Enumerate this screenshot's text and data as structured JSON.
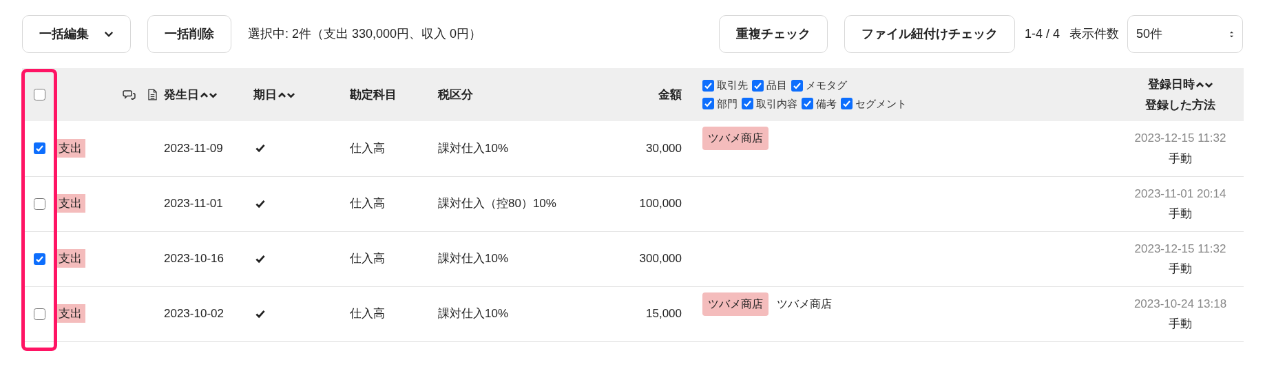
{
  "toolbar": {
    "bulk_edit": {
      "label": "一括編集"
    },
    "bulk_delete": {
      "label": "一括削除"
    },
    "selection_summary": "選択中: 2件（支出 330,000円、収入 0円）",
    "duplicate_check": {
      "label": "重複チェック"
    },
    "file_link_check": {
      "label": "ファイル紐付けチェック"
    },
    "pagination": "1-4 / 4",
    "per_page_label": "表示件数",
    "per_page": {
      "value": "50件"
    }
  },
  "table": {
    "select_all": {
      "checked": false
    },
    "columns": {
      "date": "発生日",
      "due": "期日",
      "account": "勘定科目",
      "tax": "税区分",
      "amount": "金額",
      "registered_at": "登録日時",
      "method": "登録した方法"
    },
    "display_options": [
      {
        "label": "取引先",
        "checked": true
      },
      {
        "label": "品目",
        "checked": true
      },
      {
        "label": "メモタグ",
        "checked": true
      },
      {
        "label": "部門",
        "checked": true
      },
      {
        "label": "取引内容",
        "checked": true
      },
      {
        "label": "備考",
        "checked": true
      },
      {
        "label": "セグメント",
        "checked": true
      }
    ],
    "rows": [
      {
        "selected": true,
        "type": "支出",
        "date": "2023-11-09",
        "due_settled": true,
        "account": "仕入高",
        "tax": "課対仕入10%",
        "amount": "30,000",
        "tags": [
          "ツバメ商店"
        ],
        "registered_at": "2023-12-15 11:32",
        "method": "手動"
      },
      {
        "selected": false,
        "type": "支出",
        "date": "2023-11-01",
        "due_settled": true,
        "account": "仕入高",
        "tax": "課対仕入（控80）10%",
        "amount": "100,000",
        "tags": [],
        "registered_at": "2023-11-01 20:14",
        "method": "手動"
      },
      {
        "selected": true,
        "type": "支出",
        "date": "2023-10-16",
        "due_settled": true,
        "account": "仕入高",
        "tax": "課対仕入10%",
        "amount": "300,000",
        "tags": [],
        "registered_at": "2023-12-15 11:32",
        "method": "手動"
      },
      {
        "selected": false,
        "type": "支出",
        "date": "2023-10-02",
        "due_settled": true,
        "account": "仕入高",
        "tax": "課対仕入10%",
        "amount": "15,000",
        "tags": [
          "ツバメ商店"
        ],
        "partner": "ツバメ商店",
        "registered_at": "2023-10-24 13:18",
        "method": "手動"
      }
    ]
  }
}
